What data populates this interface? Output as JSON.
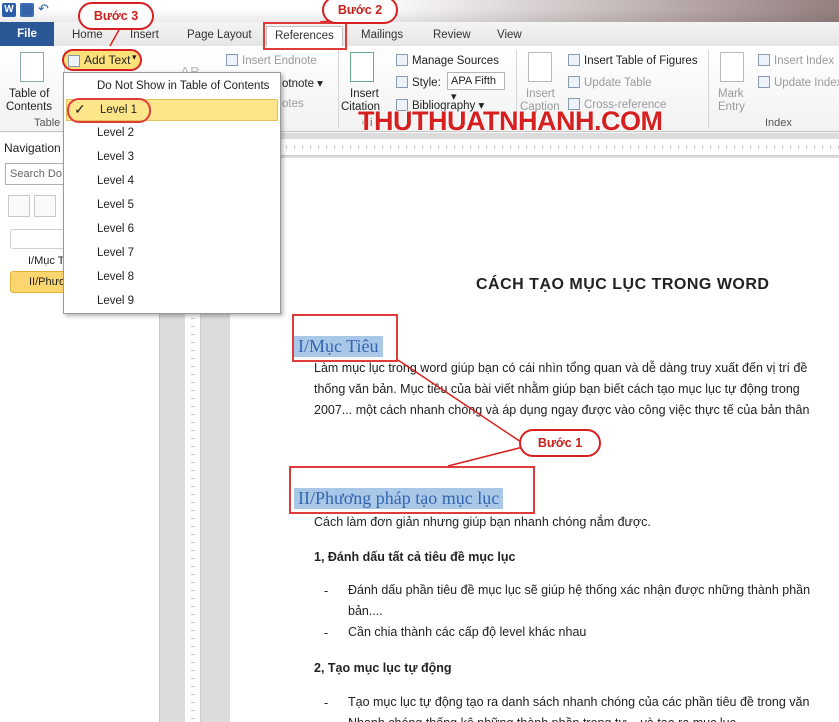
{
  "titlebar": {
    "app_icon_letter": "W"
  },
  "tabs": {
    "file": "File",
    "home": "Home",
    "insert": "Insert",
    "page_layout": "Page Layout",
    "references": "References",
    "mailings": "Mailings",
    "review": "Review",
    "view": "View"
  },
  "ribbon": {
    "toc": {
      "label_line1": "Table of",
      "label_line2": "Contents",
      "group": "Table"
    },
    "add_text": "Add Text",
    "insert_endnote": "Insert Endnote",
    "footnote_partial": "otnote",
    "notes_partial": "otes",
    "insert_citation_line1": "Insert",
    "insert_citation_line2": "Citation",
    "manage_sources": "Manage Sources",
    "style_label": "Style:",
    "style_value": "APA Fifth",
    "bibliography": "Bibliography",
    "citations_group_partial": "Ci",
    "insert_caption_line1": "Insert",
    "insert_caption_line2": "Caption",
    "insert_table_of_figures": "Insert Table of Figures",
    "update_table": "Update Table",
    "cross_reference": "Cross-reference",
    "mark_entry_line1": "Mark",
    "mark_entry_line2": "Entry",
    "insert_index": "Insert Index",
    "update_index": "Update Index",
    "index_group": "Index",
    "ab_icon": "AB"
  },
  "menu": {
    "items": [
      "Do Not Show in Table of Contents",
      "Level 1",
      "Level 2",
      "Level 3",
      "Level 4",
      "Level 5",
      "Level 6",
      "Level 7",
      "Level 8",
      "Level 9"
    ],
    "checked_index": 1
  },
  "callouts": {
    "step3": "Bước 3",
    "step2": "Bước 2",
    "step1": "Bước 1"
  },
  "watermark": "THUTHUATNHANH.COM",
  "nav": {
    "title": "Navigation",
    "search_placeholder": "Search Do",
    "items": [
      "I/Mục T",
      "II/Phươ"
    ]
  },
  "document": {
    "title": "CÁCH TẠO MỤC LỤC TRONG WORD",
    "heading1": "I/Mục Tiêu",
    "para1_line1": "Làm mục lục trong word giúp bạn có cái nhìn tổng quan và dễ dàng truy xuất đến vị trí đề",
    "para1_line2": "thống văn bản. Mục tiêu của bài viết nhằm giúp bạn biết cách tạo mục lục tự động trong",
    "para1_line3": "2007... một cách nhanh chóng và áp dụng ngay được vào công việc thực tế của bản thân",
    "heading2": "II/Phương pháp tạo mục lục",
    "para2": "Cách làm đơn giản nhưng giúp bạn nhanh chóng nắm được.",
    "sub1": "1, Đánh dấu tất cả tiêu đề mục lục",
    "bullet1_line1": "Đánh dấu phần tiêu đề mục lục sẽ giúp hệ thống xác nhận được những thành phần",
    "bullet1_line2": "bản....",
    "bullet2": "Cần chia thành các cấp độ level khác nhau",
    "sub2": "2,  Tạo mục lục tự động",
    "bullet3": "Tạo mục lục tự động tạo ra danh sách nhanh chóng của các phần tiêu đề trong văn",
    "bullet4_partial": "Nhanh chóng thống kê những thành phần trong tư... và tạo ra mục lục",
    "dash": "-"
  },
  "colors": {
    "accent_red": "#d92020",
    "file_tab": "#2b5797",
    "highlight_yellow": "#fde58a",
    "heading_blue": "#3466b0",
    "heading_bg": "#a9c7e6"
  }
}
